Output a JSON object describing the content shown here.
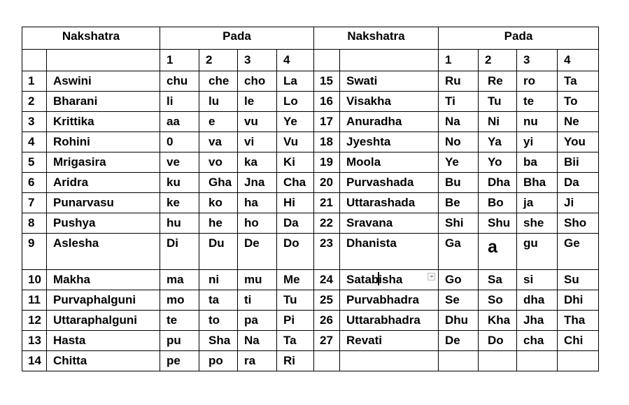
{
  "header": {
    "left_title": "Nakshatra",
    "left_pada": "Pada",
    "right_title": "Nakshatra",
    "right_pada": "Pada",
    "pada_numbers": [
      "1",
      "2",
      "3",
      "4"
    ]
  },
  "left_rows": [
    {
      "num": "1",
      "name": "Aswini",
      "padas": [
        "chu",
        "che",
        "cho",
        "La"
      ]
    },
    {
      "num": "2",
      "name": "Bharani",
      "padas": [
        "li",
        "lu",
        "le",
        "Lo"
      ]
    },
    {
      "num": "3",
      "name": "Krittika",
      "padas": [
        "aa",
        "e",
        "vu",
        "Ye"
      ]
    },
    {
      "num": "4",
      "name": "Rohini",
      "padas": [
        "0",
        "va",
        "vi",
        "Vu"
      ]
    },
    {
      "num": "5",
      "name": "Mrigasira",
      "padas": [
        "ve",
        "vo",
        "ka",
        "Ki"
      ]
    },
    {
      "num": "6",
      "name": "Aridra",
      "padas": [
        "ku",
        "Gha",
        "Jna",
        "Cha"
      ]
    },
    {
      "num": "7",
      "name": "Punarvasu",
      "padas": [
        "ke",
        "ko",
        "ha",
        "Hi"
      ]
    },
    {
      "num": "8",
      "name": "Pushya",
      "padas": [
        "hu",
        "he",
        "ho",
        "Da"
      ]
    },
    {
      "num": "9",
      "name": "Aslesha",
      "padas": [
        "Di",
        "Du",
        "De",
        "Do"
      ]
    },
    {
      "num": "10",
      "name": "Makha",
      "padas": [
        "ma",
        "ni",
        "mu",
        "Me"
      ]
    },
    {
      "num": "11",
      "name": "Purvaphalguni",
      "padas": [
        "mo",
        "ta",
        "ti",
        "Tu"
      ]
    },
    {
      "num": "12",
      "name": "Uttaraphalguni",
      "padas": [
        "te",
        "to",
        "pa",
        "Pi"
      ]
    },
    {
      "num": "13",
      "name": "Hasta",
      "padas": [
        "pu",
        "Sha",
        "Na",
        "Ta"
      ]
    },
    {
      "num": "14",
      "name": "Chitta",
      "padas": [
        "pe",
        "po",
        "ra",
        "Ri"
      ]
    }
  ],
  "right_rows": [
    {
      "num": "15",
      "name": "Swati",
      "padas": [
        "Ru",
        "Re",
        "ro",
        "Ta"
      ]
    },
    {
      "num": "16",
      "name": "Visakha",
      "padas": [
        "Ti",
        "Tu",
        "te",
        "To"
      ]
    },
    {
      "num": "17",
      "name": "Anuradha",
      "padas": [
        "Na",
        "Ni",
        "nu",
        "Ne"
      ]
    },
    {
      "num": "18",
      "name": "Jyeshta",
      "padas": [
        "No",
        "Ya",
        "yi",
        "You"
      ]
    },
    {
      "num": "19",
      "name": "Moola",
      "padas": [
        "Ye",
        "Yo",
        "ba",
        "Bii"
      ]
    },
    {
      "num": "20",
      "name": "Purvashada",
      "padas": [
        "Bu",
        "Dha",
        "Bha",
        "Da"
      ]
    },
    {
      "num": "21",
      "name": "Uttarashada",
      "padas": [
        "Be",
        "Bo",
        "ja",
        "Ji"
      ]
    },
    {
      "num": "22",
      "name": "Sravana",
      "padas": [
        "Shi",
        "Shu",
        "she",
        "Sho"
      ]
    },
    {
      "num": "23",
      "name": "Dhanista",
      "padas": [
        "Ga",
        "a",
        "gu",
        "Ge"
      ]
    },
    {
      "num": "24",
      "name_before_caret": "Satab",
      "name_after_caret": "isha",
      "padas": [
        "Go",
        "Sa",
        "si",
        "Su"
      ]
    },
    {
      "num": "25",
      "name": "Purvabhadra",
      "padas": [
        "Se",
        "So",
        "dha",
        "Dhi"
      ]
    },
    {
      "num": "26",
      "name": "Uttarabhadra",
      "padas": [
        "Dhu",
        "Kha",
        "Jha",
        "Tha"
      ]
    },
    {
      "num": "27",
      "name": "Revati",
      "padas": [
        "De",
        "Do",
        "cha",
        "Chi"
      ]
    },
    {
      "num": "",
      "name": "",
      "padas": [
        "",
        "",
        "",
        ""
      ]
    }
  ]
}
